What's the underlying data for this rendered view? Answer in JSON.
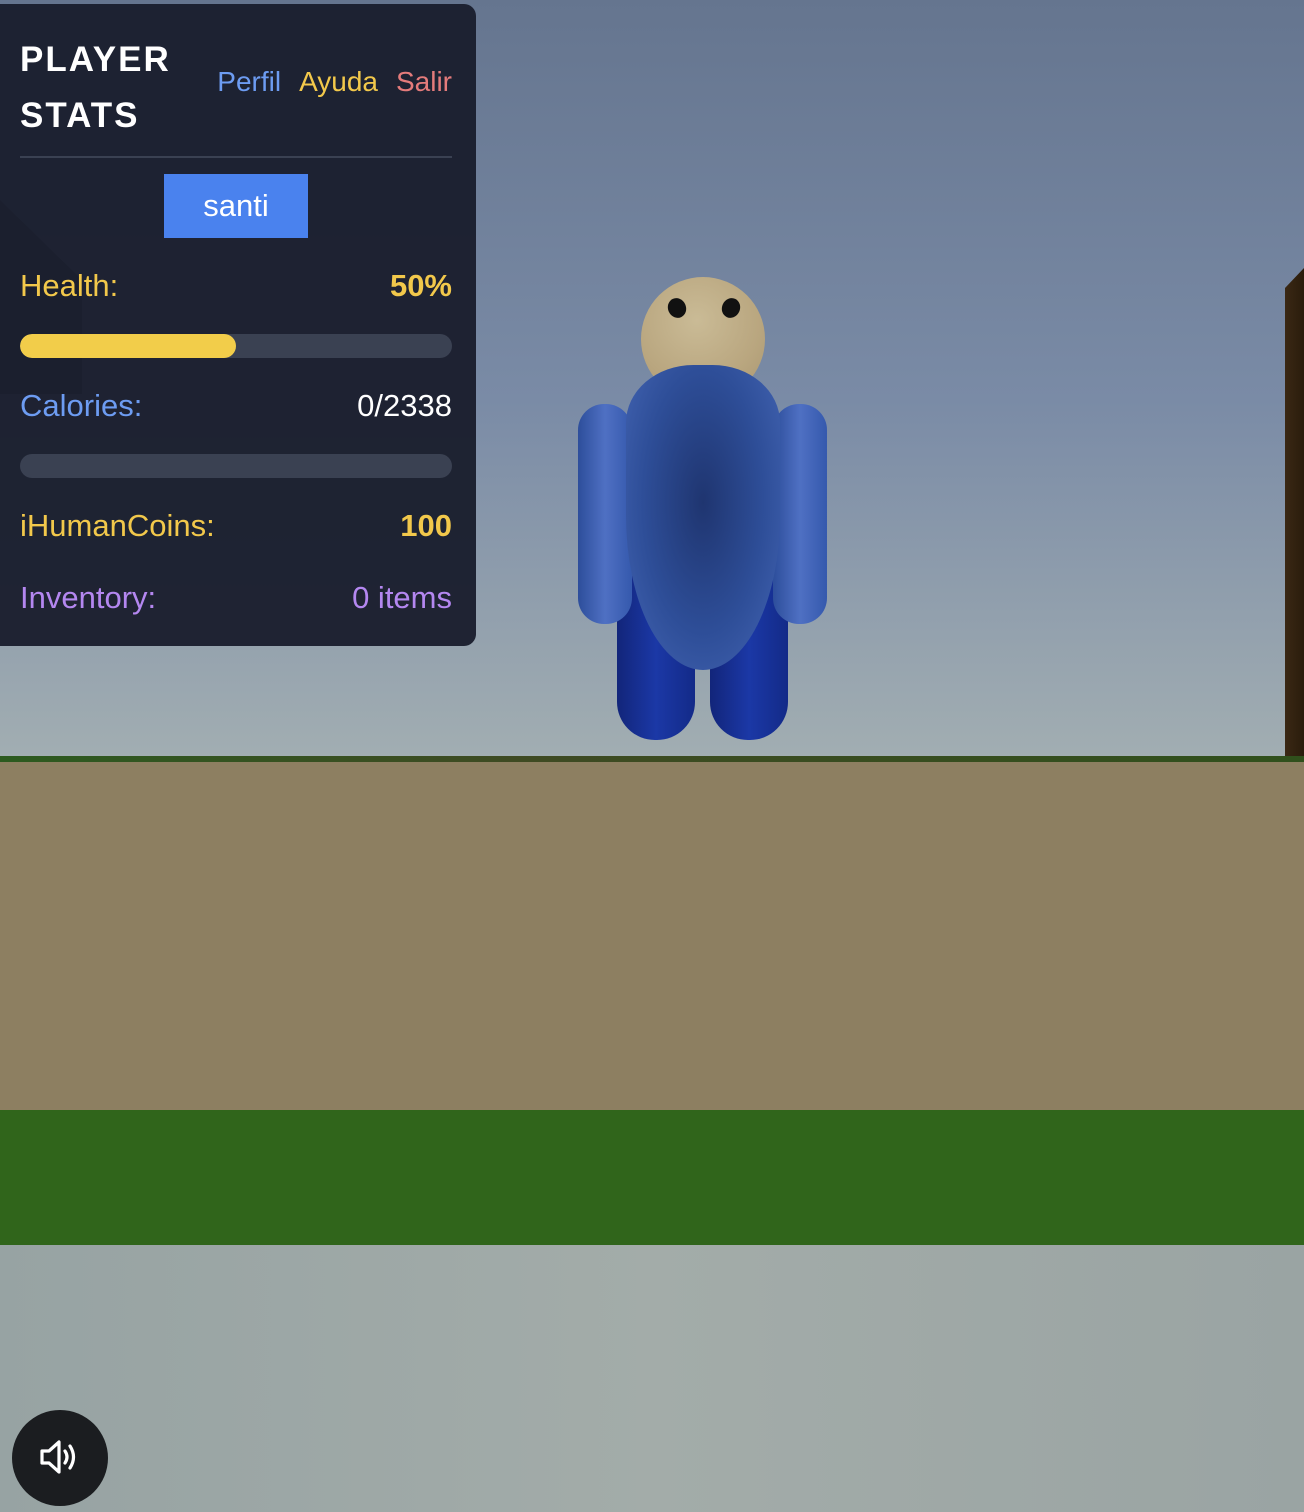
{
  "panel": {
    "title": "PLAYER STATS",
    "nav": {
      "perfil": "Perfil",
      "ayuda": "Ayuda",
      "salir": "Salir"
    },
    "username": "santi",
    "health": {
      "label": "Health:",
      "value_text": "50%",
      "fraction": 0.5
    },
    "calories": {
      "label": "Calories:",
      "value_text": "0/2338",
      "current": 0,
      "max": 2338
    },
    "coins": {
      "label": "iHumanCoins:",
      "value_text": "100"
    },
    "inventory": {
      "label": "Inventory:",
      "value_text": "0 items"
    }
  },
  "sound_button": {
    "icon": "speaker-volume-icon"
  },
  "colors": {
    "panel_bg": "#1b1f2e",
    "accent_blue": "#4a82ee",
    "health_yellow": "#f2c84b",
    "calories_blue": "#6d9cf2",
    "inventory_purple": "#b487f0",
    "salir_red": "#e47b7b"
  }
}
